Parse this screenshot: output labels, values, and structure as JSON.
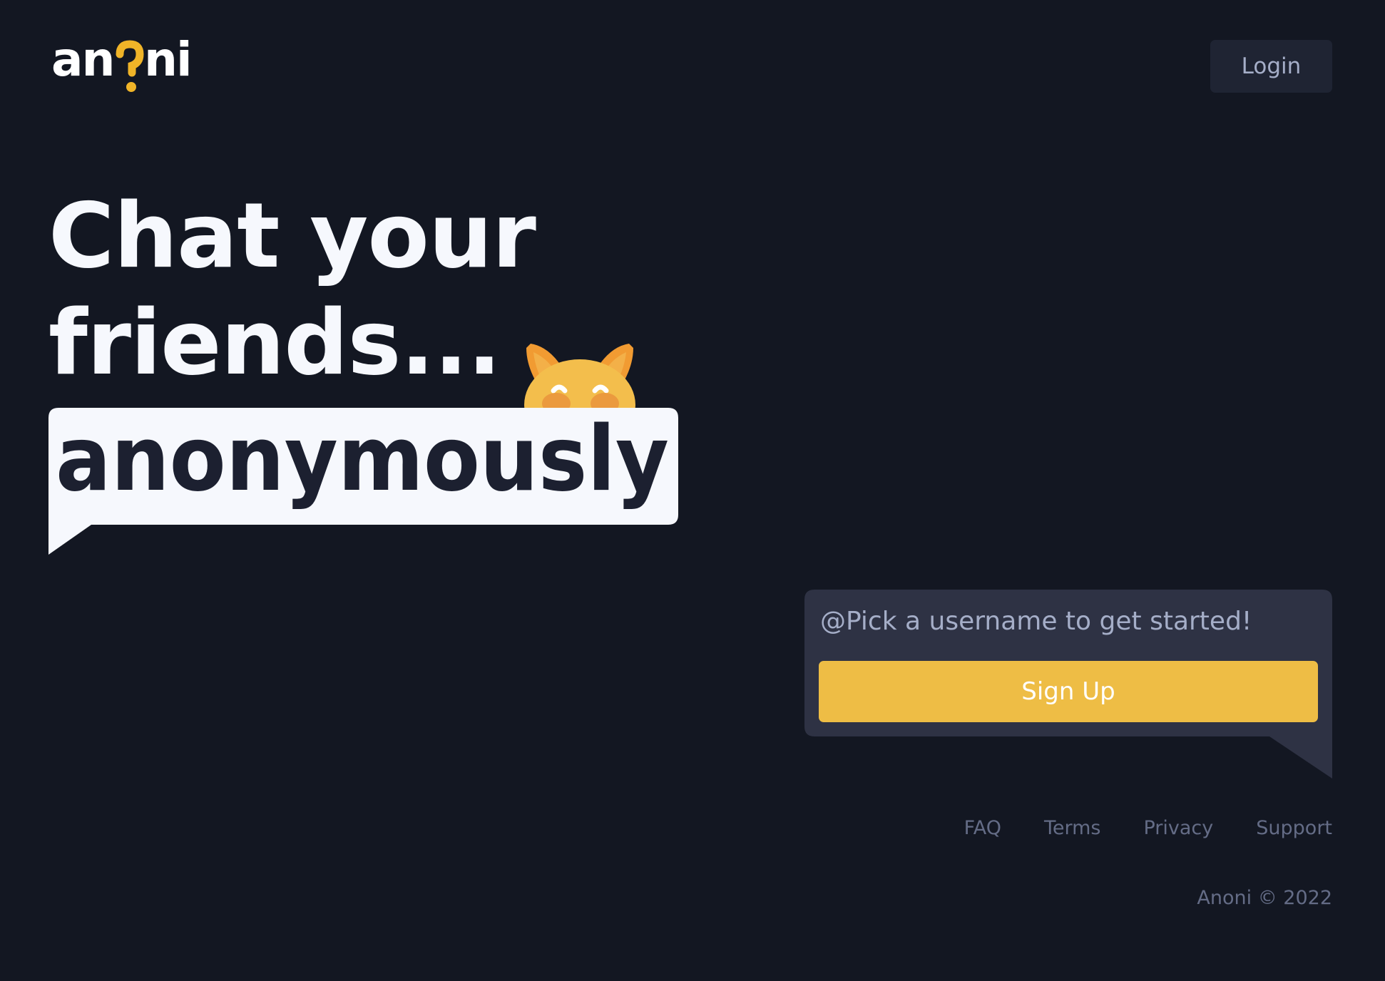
{
  "header": {
    "logo_text": "anoni",
    "login_label": "Login"
  },
  "hero": {
    "line1": "Chat your",
    "line2": "friends...",
    "highlight": "anonymously"
  },
  "signup": {
    "placeholder": "@Pick a username to get started!",
    "button_label": "Sign Up"
  },
  "footer": {
    "links": [
      "FAQ",
      "Terms",
      "Privacy",
      "Support"
    ],
    "copyright": "Anoni © 2022"
  },
  "colors": {
    "background": "#131722",
    "accent": "#eebd45",
    "panel": "#2e3244",
    "text_light": "#f6f8fd",
    "text_muted": "#646c86"
  }
}
